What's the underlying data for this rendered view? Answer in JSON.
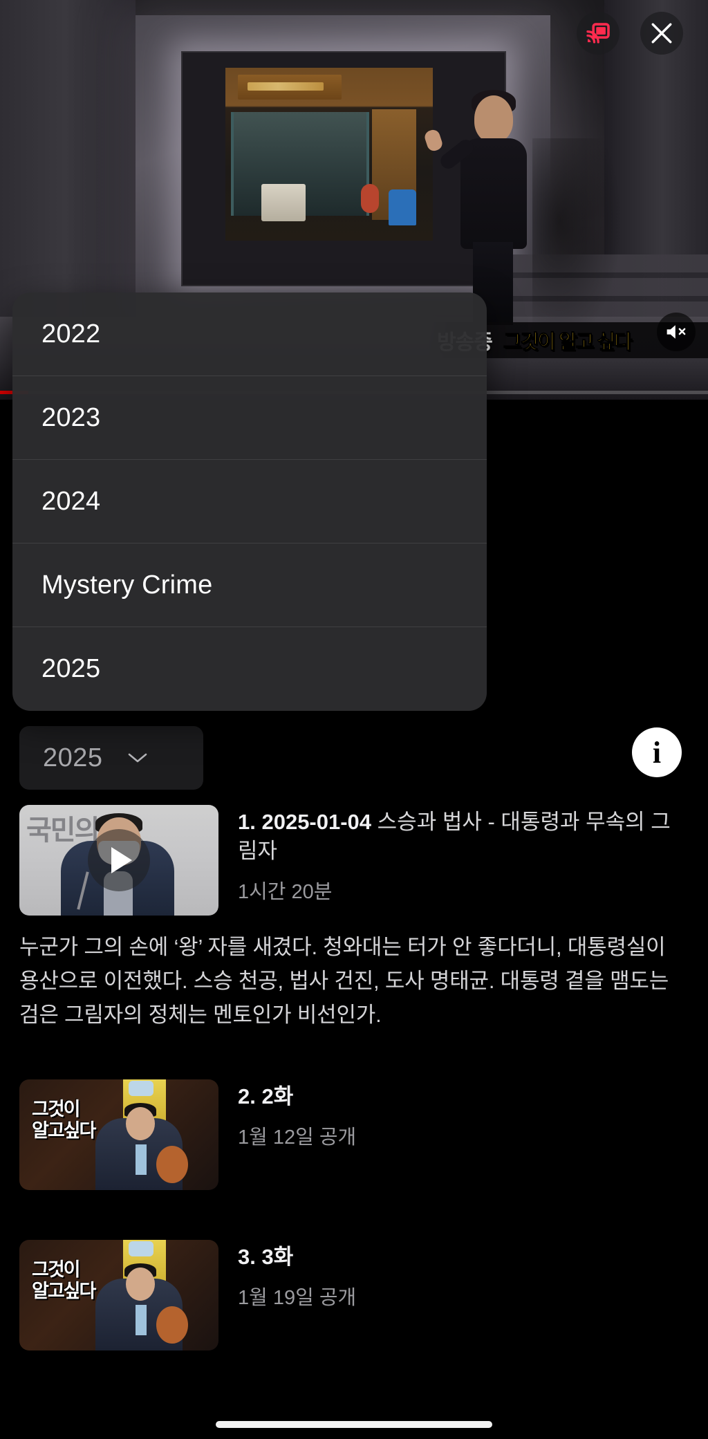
{
  "player": {
    "overlay_caption_word": "방송중",
    "overlay_brand": "그것이 알고 싶다",
    "cast_icon": "cast-icon",
    "close_icon": "close-icon",
    "mute_icon": "mute-icon",
    "progress_percent": 4,
    "accent_color": "#e60000",
    "cast_color": "#ff2b4e"
  },
  "dropdown": {
    "open": true,
    "options": [
      {
        "label": "2022"
      },
      {
        "label": "2023"
      },
      {
        "label": "2024"
      },
      {
        "label": "Mystery Crime"
      },
      {
        "label": "2025"
      }
    ]
  },
  "season_selector": {
    "selected": "2025",
    "chevron_icon": "chevron-down-icon",
    "info_label": "i"
  },
  "episodes": [
    {
      "title_prefix": "1. 2025-01-04",
      "title_rest": " 스승과 법사 - 대통령과 무속의 그림자",
      "subtitle": "1시간 20분",
      "description": "누군가 그의 손에 ‘왕’ 자를 새겼다. 청와대는 터가 안 좋다더니, 대통령실이 용산으로 이전했다. 스승 천공, 법사 건진, 도사 명태균. 대통령 곁을 맴도는 검은 그림자의 정체는 멘토인가 비선인가.",
      "thumb_kind": "press",
      "thumb_banner_text": "국민의힘",
      "has_play_button": true
    },
    {
      "title_prefix": "2. 2화",
      "title_rest": "",
      "subtitle": "1월 12일 공개",
      "description": "",
      "thumb_kind": "titlecard",
      "thumb_logo_line1": "그것이",
      "thumb_logo_line2": "알고싶다",
      "has_play_button": false
    },
    {
      "title_prefix": "3. 3화",
      "title_rest": "",
      "subtitle": "1월 19일 공개",
      "description": "",
      "thumb_kind": "titlecard",
      "thumb_logo_line1": "그것이",
      "thumb_logo_line2": "알고싶다",
      "has_play_button": false
    }
  ]
}
